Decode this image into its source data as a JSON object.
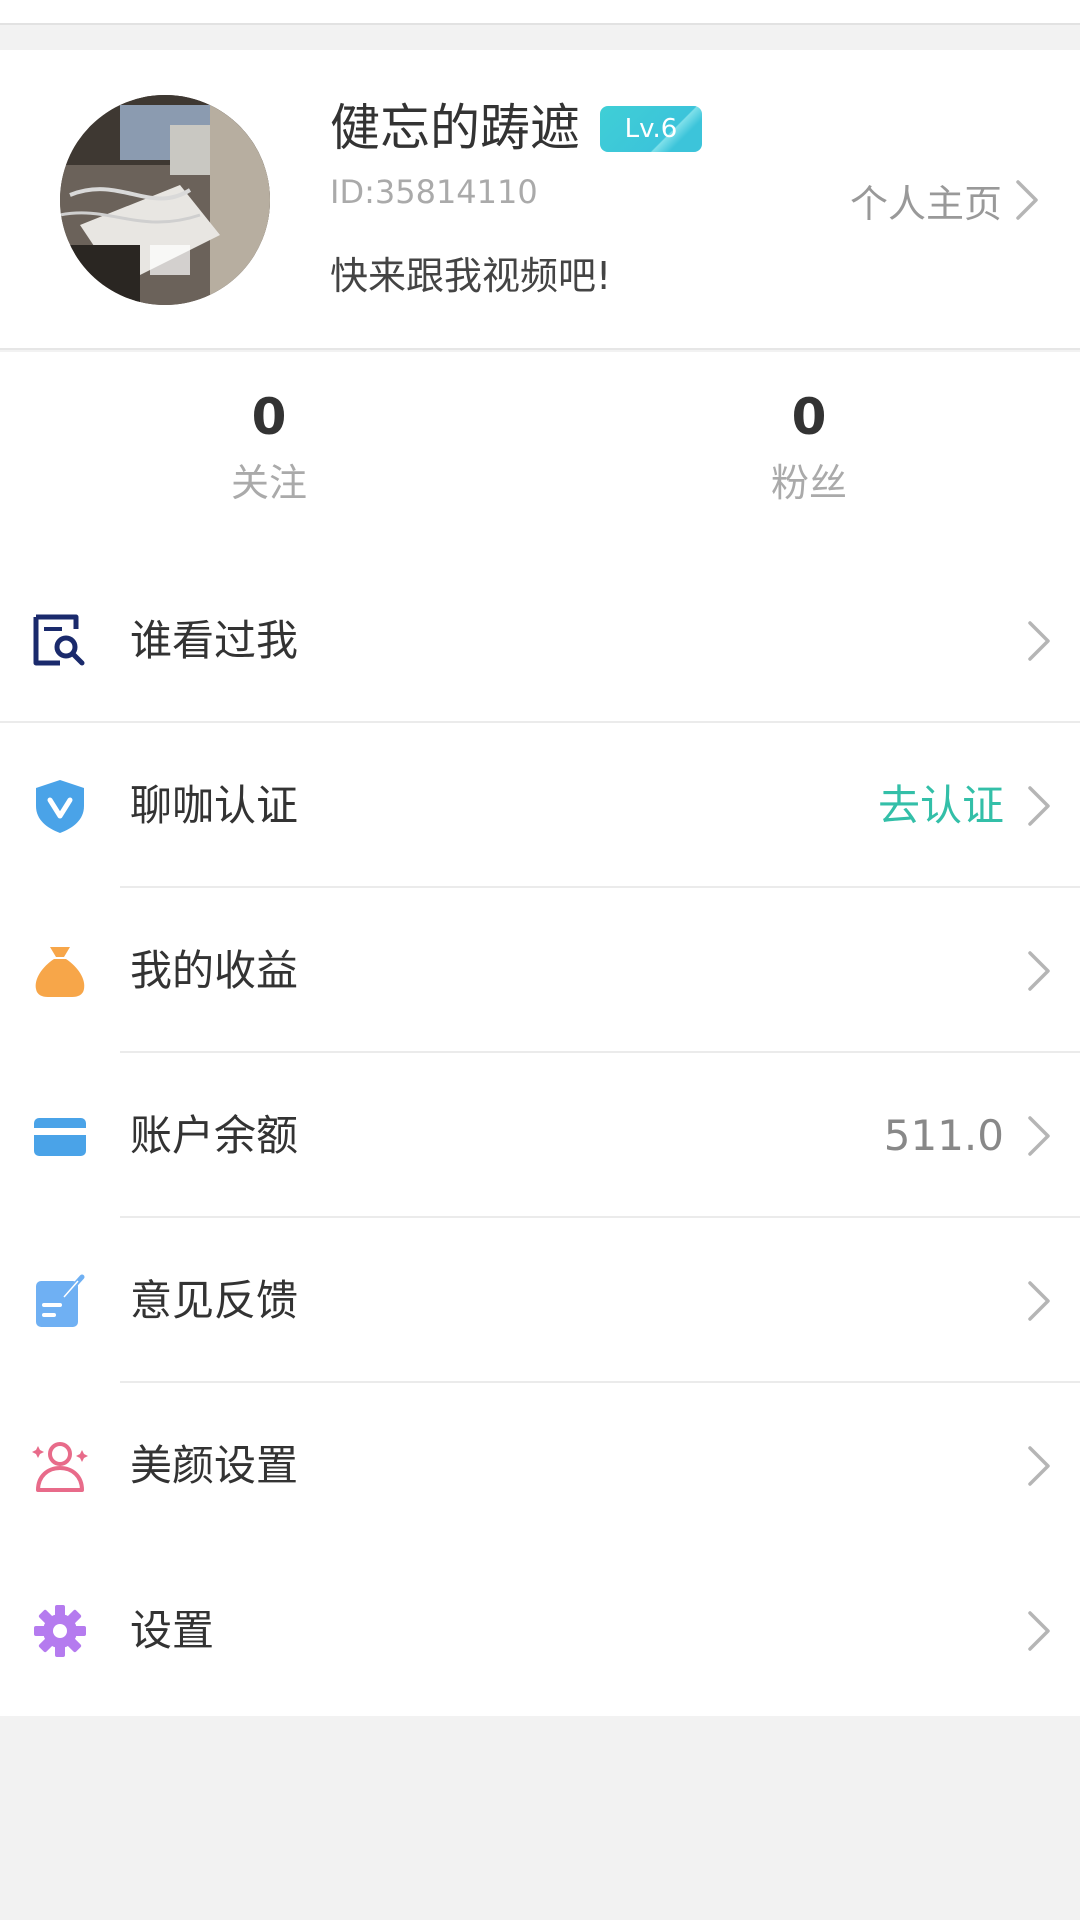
{
  "profile": {
    "nickname": "健忘的踌遮",
    "level": "Lv.6",
    "user_id": "ID:35814110",
    "signature": "快来跟我视频吧!",
    "home_link": "个人主页"
  },
  "stats": {
    "following_count": "0",
    "following_label": "关注",
    "fans_count": "0",
    "fans_label": "粉丝"
  },
  "menu": [
    {
      "label": "谁看过我",
      "icon": "visitor-search-icon",
      "value": ""
    },
    {
      "label": "聊咖认证",
      "icon": "verify-shield-icon",
      "value": "去认证"
    },
    {
      "label": "我的收益",
      "icon": "money-bag-icon",
      "value": ""
    },
    {
      "label": "账户余额",
      "icon": "card-icon",
      "value": "511.0"
    },
    {
      "label": "意见反馈",
      "icon": "feedback-note-icon",
      "value": ""
    },
    {
      "label": "美颜设置",
      "icon": "beauty-person-icon",
      "value": ""
    },
    {
      "label": "设置",
      "icon": "gear-icon",
      "value": ""
    }
  ],
  "colors": {
    "accent_teal": "#33bfa8",
    "badge": "#3cc4da",
    "icon_navy": "#1a2a6c",
    "icon_blue": "#4aa3e8",
    "icon_orange": "#f7a649",
    "icon_pink": "#e86b8a",
    "icon_purple": "#b57bef"
  }
}
